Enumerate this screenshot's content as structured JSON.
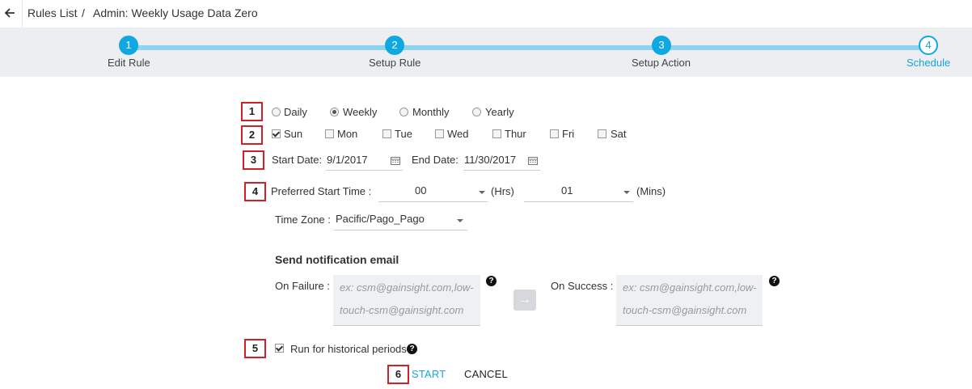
{
  "breadcrumb": {
    "rules_list": "Rules List",
    "separator": "/",
    "current": "Admin: Weekly Usage Data Zero"
  },
  "stepper": {
    "steps": [
      {
        "number": "1",
        "label": "Edit Rule",
        "state": "done"
      },
      {
        "number": "2",
        "label": "Setup Rule",
        "state": "done"
      },
      {
        "number": "3",
        "label": "Setup Action",
        "state": "done"
      },
      {
        "number": "4",
        "label": "Schedule",
        "state": "active"
      }
    ]
  },
  "markers": [
    "1",
    "2",
    "3",
    "4",
    "5",
    "6"
  ],
  "frequency": {
    "options": [
      "Daily",
      "Weekly",
      "Monthly",
      "Yearly"
    ],
    "selected": "Weekly"
  },
  "days": {
    "options": [
      "Sun",
      "Mon",
      "Tue",
      "Wed",
      "Thur",
      "Fri",
      "Sat"
    ],
    "checked": [
      "Sun"
    ]
  },
  "dates": {
    "start_label": "Start Date:",
    "start_value": "9/1/2017",
    "end_label": "End Date:",
    "end_value": "11/30/2017"
  },
  "start_time": {
    "label": "Preferred Start Time :",
    "hours": "00",
    "hours_unit": "(Hrs)",
    "minutes": "01",
    "minutes_unit": "(Mins)"
  },
  "time_zone": {
    "label": "Time Zone :",
    "value": "Pacific/Pago_Pago"
  },
  "notification": {
    "title": "Send notification email",
    "failure_label": "On Failure :",
    "failure_placeholder_line1": "ex: csm@gainsight.com,low-",
    "failure_placeholder_line2": "touch-csm@gainsight.com",
    "success_label": "On Success :",
    "success_placeholder_line1": "ex: csm@gainsight.com,low-",
    "success_placeholder_line2": "touch-csm@gainsight.com",
    "help_glyph": "?",
    "copy_arrow": "→"
  },
  "historical": {
    "label": "Run for historical periods",
    "checked": true
  },
  "actions": {
    "start": "START",
    "cancel": "CANCEL"
  },
  "colors": {
    "accent": "#0fa8e0",
    "track": "#8fd3ef",
    "stepper_bg": "#eceef1",
    "marker_border": "#d0202a"
  }
}
